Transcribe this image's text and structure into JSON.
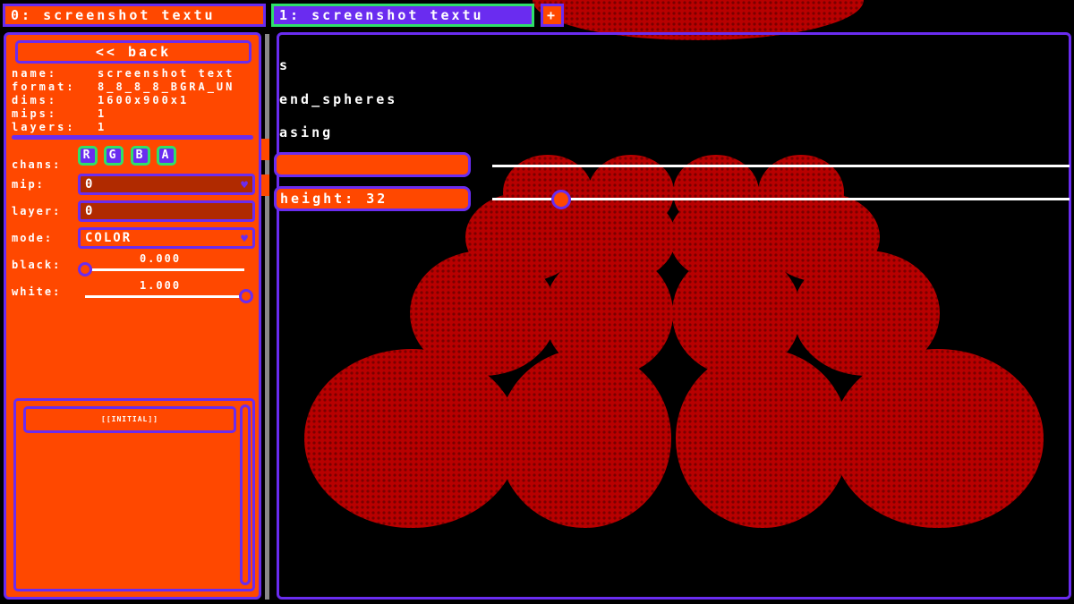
{
  "tabs": [
    {
      "label": "0: screenshot textu"
    },
    {
      "label": "1: screenshot textu"
    }
  ],
  "tab_add_label": "+",
  "panel": {
    "back_label": "<< back",
    "info": {
      "name_label": "name:",
      "name_value": "screenshot text",
      "format_label": "format:",
      "format_value": "8_8_8_8_BGRA_UN",
      "dims_label": "dims:",
      "dims_value": "1600x900x1",
      "mips_label": "mips:",
      "mips_value": "1",
      "layers_label": "layers:",
      "layers_value": "1"
    },
    "chans_label": "chans:",
    "chans": [
      "R",
      "G",
      "B",
      "A"
    ],
    "mip_label": "mip:",
    "mip_value": "0",
    "layer_label": "layer:",
    "layer_value": "0",
    "mode_label": "mode:",
    "mode_value": "COLOR",
    "black_label": "black:",
    "black_value": "0.000",
    "white_label": "white:",
    "white_value": "1.000",
    "list_item": "[[INITIAL]]"
  },
  "viewport": {
    "line1": "s",
    "line2": "end_spheres",
    "line3": "asing",
    "field1": "",
    "field2": "height: 32"
  },
  "colors": {
    "accent_orange": "#ff4800",
    "accent_purple": "#6a2cf0",
    "accent_green": "#2ee06a",
    "sphere_red": "#b00000"
  }
}
